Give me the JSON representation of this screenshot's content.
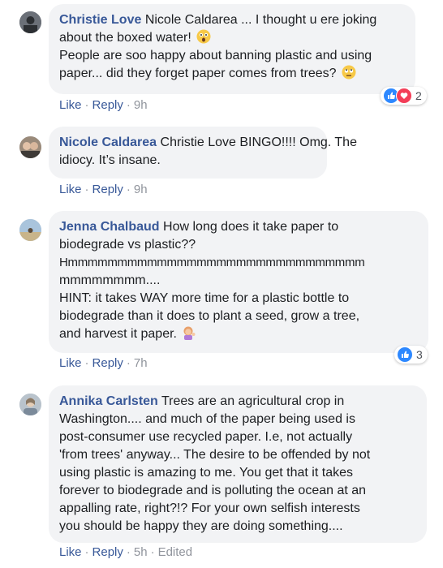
{
  "colors": {
    "author": "#385898",
    "bubble": "#f2f3f5",
    "meta": "#90949c",
    "like_blue": "#2d88ff",
    "love_red": "#f33e58"
  },
  "comments": [
    {
      "author": "Christie Love",
      "lines": [
        "Nicole Caldarea ... I thought u ere joking",
        "about the boxed water!",
        "People are soo happy about banning plastic and using",
        "paper... did they forget paper comes from trees?"
      ],
      "mention": "Nicole Caldarea",
      "emojis": [
        "astonished-face",
        "rolling-eyes-face"
      ],
      "actions": {
        "like": "Like",
        "reply": "Reply",
        "time": "9h"
      },
      "reactions": {
        "icons": [
          "like-icon",
          "love-icon"
        ],
        "count": "2"
      }
    },
    {
      "author": "Nicole Caldarea",
      "lines": [
        "Christie Love BINGO!!!! Omg. The",
        "idiocy. It’s insane."
      ],
      "actions": {
        "like": "Like",
        "reply": "Reply",
        "time": "9h"
      }
    },
    {
      "author": "Jenna Chalbaud",
      "lines": [
        "How long does it take paper to",
        "biodegrade vs plastic??",
        "Hmmmmmmmmmmmmmmmmmmmmmmmmmmmmmm",
        "mmmmmmmm....",
        "HINT: it takes WAY more time for a plastic bottle to",
        "biodegrade than it does to plant a seed, grow a tree,",
        "and harvest it paper."
      ],
      "emojis": [
        "woman-tipping-hand"
      ],
      "actions": {
        "like": "Like",
        "reply": "Reply",
        "time": "7h"
      },
      "reactions": {
        "icons": [
          "like-icon"
        ],
        "count": "3"
      }
    },
    {
      "author": "Annika Carlsten",
      "lines": [
        "Trees are an agricultural crop in",
        "Washington.... and much of the paper being used is",
        "post-consumer use recycled paper. I.e, not actually",
        "'from trees' anyway... The desire to be offended by not",
        "using plastic is amazing to me. You get that it takes",
        "forever to biodegrade and is polluting the ocean at an",
        "appalling rate, right?!? For your own selfish interests",
        "you should be happy they are doing something...."
      ],
      "actions": {
        "like": "Like",
        "reply": "Reply",
        "time": "5h",
        "edited": "Edited"
      }
    }
  ]
}
